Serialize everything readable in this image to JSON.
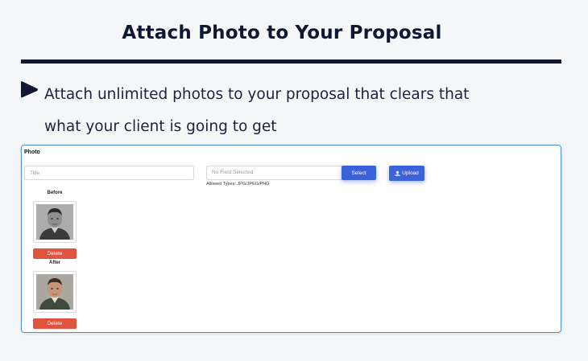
{
  "heading": "Attach Photo to Your Proposal",
  "description": {
    "line1": "Attach unlimited photos to your proposal that clears that",
    "line2": "what your client is going to get"
  },
  "icons": {
    "bullet": "play-triangle-icon",
    "upload": "upload-icon"
  },
  "colors": {
    "heading": "#0f1733",
    "panel_border": "#4a90d9",
    "primary_button": "#3b63d9",
    "delete_button": "#e0533f"
  },
  "form": {
    "section_title": "Photo",
    "title_placeholder": "Title",
    "file_field_text": "No Field Selected",
    "select_label": "Select",
    "upload_label": "Upload",
    "allowed_types": "Allowed Types: JPG/JPEG/PNG"
  },
  "photos": [
    {
      "label": "Before",
      "delete_label": "Delete",
      "image": "black-and-white-portrait"
    },
    {
      "label": "After",
      "delete_label": "Delete",
      "image": "colorized-portrait"
    }
  ]
}
